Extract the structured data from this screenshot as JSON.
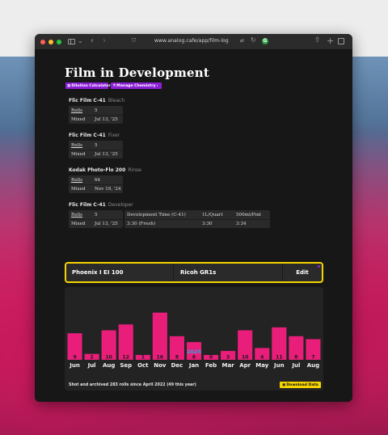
{
  "browser": {
    "url": "www.analog.cafe/app/film-log"
  },
  "page": {
    "title": "Film in Development",
    "buttons": {
      "dilution": "Dilution Calculator",
      "manage": "Manage Chemistry"
    }
  },
  "chemistry": [
    {
      "name": "Flic Film C-41",
      "stage": "Bleach",
      "rolls_label": "Rolls",
      "rolls": "5",
      "mixed_label": "Mixed",
      "mixed": "Jul 13, '25"
    },
    {
      "name": "Flic Film C-41",
      "stage": "Fixer",
      "rolls_label": "Rolls",
      "rolls": "5",
      "mixed_label": "Mixed",
      "mixed": "Jul 13, '25"
    },
    {
      "name": "Kodak Photo-Flo 200",
      "stage": "Rinse",
      "rolls_label": "Rolls",
      "rolls": "64",
      "mixed_label": "Mixed",
      "mixed": "Nov 19, '24"
    },
    {
      "name": "Flic Film C-41",
      "stage": "Developer",
      "rolls_label": "Rolls",
      "rolls": "5",
      "mixed_label": "Mixed",
      "mixed": "Jul 13, '25"
    }
  ],
  "dev_time": {
    "header": [
      "Development Time (C-41)",
      "1L/Quart",
      "500ml/Pint"
    ],
    "row": [
      "3:30 (Fresh)",
      "3:30",
      "3:34"
    ]
  },
  "current": {
    "film": "Phoenix I EI 100",
    "camera": "Ricoh GR1s",
    "edit": "Edit"
  },
  "footer": {
    "summary": "Shot and archived 283 rolls since April 2022 (49 this year)",
    "download": "Download Data"
  },
  "colors": {
    "accent": "#8b1fd6",
    "highlight": "#f5d400",
    "bar": "#e91e7a",
    "year_label": "#29a8e0"
  },
  "chart_data": {
    "type": "bar",
    "categories": [
      "Jun",
      "Jul",
      "Aug",
      "Sep",
      "Oct",
      "Nov",
      "Dec",
      "Jan",
      "Feb",
      "Mar",
      "Apr",
      "May",
      "Jun",
      "Jul",
      "Aug"
    ],
    "values": [
      9,
      2,
      10,
      12,
      1,
      16,
      8,
      6,
      0,
      3,
      10,
      4,
      11,
      8,
      7
    ],
    "annotations": [
      {
        "category_index": 7,
        "text": "2025"
      }
    ],
    "title": "",
    "xlabel": "",
    "ylabel": "",
    "ylim": [
      0,
      17
    ]
  }
}
